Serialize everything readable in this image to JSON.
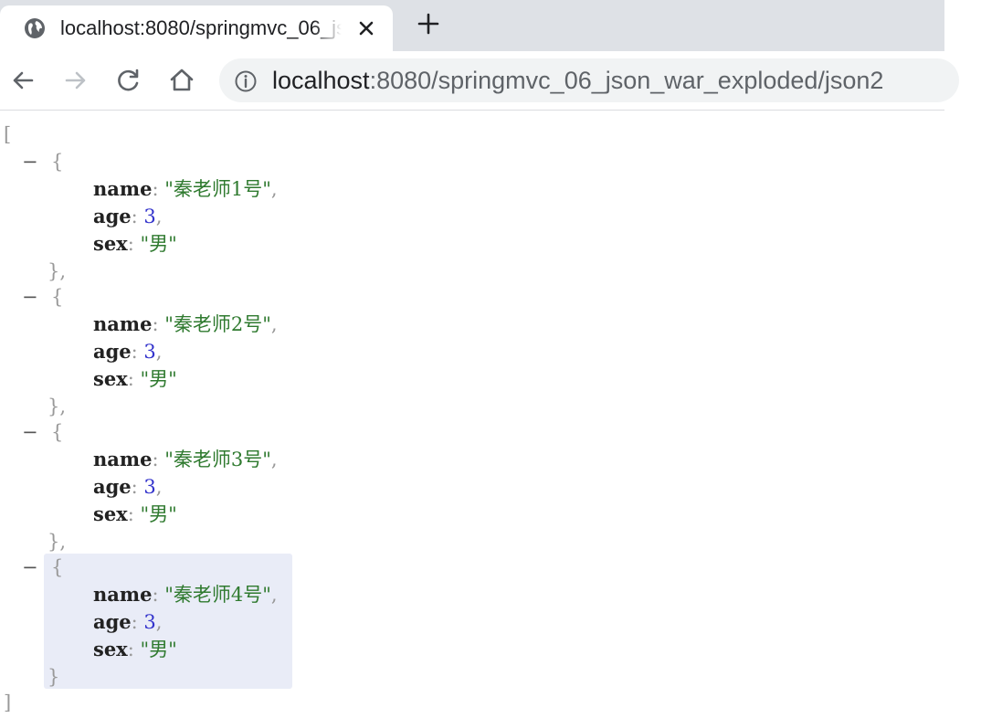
{
  "tab": {
    "title": "localhost:8080/springmvc_06_json_war_exploded/json2"
  },
  "address_bar": {
    "url_host": "localhost",
    "url_path": ":8080/springmvc_06_json_war_exploded/json2"
  },
  "icons": {
    "tab_favicon": "globe-icon",
    "tab_close": "close-icon",
    "new_tab": "plus-icon",
    "back": "arrow-left-icon",
    "forward": "arrow-right-icon",
    "reload": "reload-icon",
    "home": "home-icon",
    "site_info": "info-icon"
  },
  "json_view": {
    "open_bracket": "[",
    "close_bracket": "]",
    "collapse_symbol": "−",
    "items": [
      {
        "name_key": "name",
        "name": "\"秦老师1号\"",
        "age_key": "age",
        "age": "3",
        "sex_key": "sex",
        "sex": "\"男\""
      },
      {
        "name_key": "name",
        "name": "\"秦老师2号\"",
        "age_key": "age",
        "age": "3",
        "sex_key": "sex",
        "sex": "\"男\""
      },
      {
        "name_key": "name",
        "name": "\"秦老师3号\"",
        "age_key": "age",
        "age": "3",
        "sex_key": "sex",
        "sex": "\"男\""
      },
      {
        "name_key": "name",
        "name": "\"秦老师4号\"",
        "age_key": "age",
        "age": "3",
        "sex_key": "sex",
        "sex": "\"男\""
      }
    ]
  },
  "colors": {
    "tabstrip_bg": "#dee1e6",
    "omnibox_bg": "#f1f3f4",
    "string_value": "#2f7a2f",
    "number_value": "#3333cc",
    "highlight": "#e9ecf7"
  }
}
